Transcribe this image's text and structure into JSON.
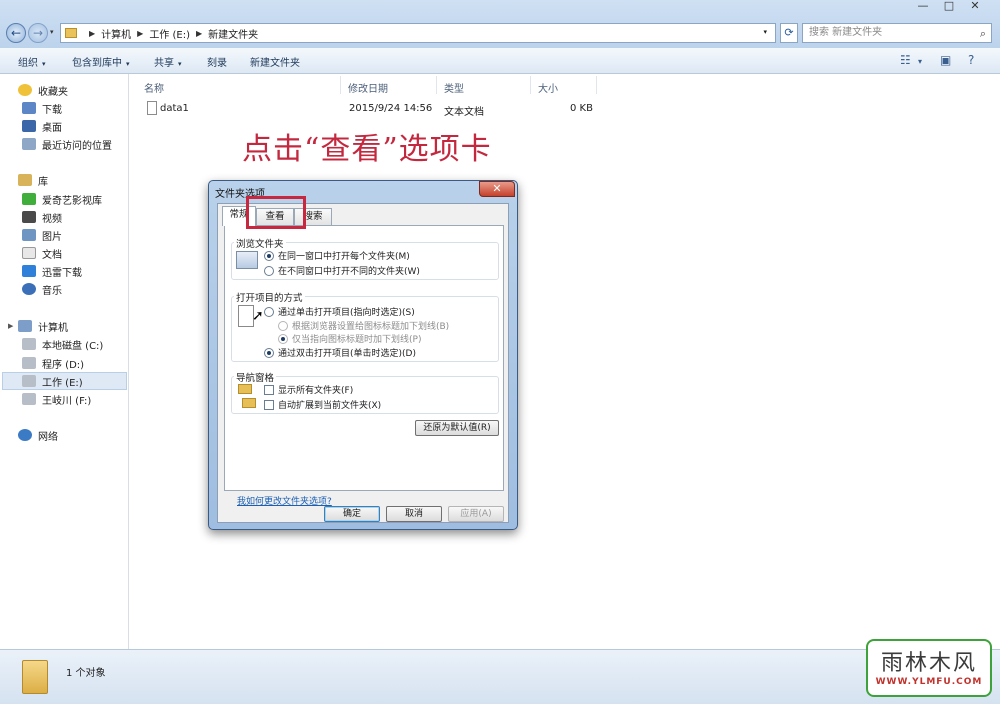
{
  "window": {
    "minimize": "—",
    "maximize": "□",
    "close": "✕",
    "breadcrumb": [
      "计算机",
      "工作 (E:)",
      "新建文件夹"
    ],
    "search_placeholder": "搜索 新建文件夹",
    "back_icon": "←",
    "forward_icon": "→",
    "refresh_icon": "⟳"
  },
  "toolbar": {
    "organize": "组织",
    "include_library": "包含到库中",
    "share": "共享",
    "burn": "刻录",
    "new_folder": "新建文件夹",
    "arrow": "▾"
  },
  "sidebar": {
    "favorites": "收藏夹",
    "downloads": "下载",
    "desktop": "桌面",
    "recent": "最近访问的位置",
    "libraries": "库",
    "iqiyi": "爱奇艺影视库",
    "videos": "视频",
    "pictures": "图片",
    "documents": "文档",
    "xunlei": "迅雷下载",
    "music": "音乐",
    "computer": "计算机",
    "drive_c": "本地磁盘 (C:)",
    "drive_d": "程序 (D:)",
    "drive_e": "工作 (E:)",
    "drive_f": "王岐川 (F:)",
    "network": "网络"
  },
  "filelist": {
    "columns": {
      "name": "名称",
      "modified": "修改日期",
      "type": "类型",
      "size": "大小"
    },
    "rows": [
      {
        "name": "data1",
        "modified": "2015/9/24 14:56",
        "type": "文本文档",
        "size": "0 KB"
      }
    ]
  },
  "annotation": "点击“查看”选项卡",
  "dialog": {
    "title": "文件夹选项",
    "close": "✕",
    "tabs": [
      "常规",
      "查看",
      "搜索"
    ],
    "browse_group": "浏览文件夹",
    "browse_same": "在同一窗口中打开每个文件夹(M)",
    "browse_new": "在不同窗口中打开不同的文件夹(W)",
    "click_group": "打开项目的方式",
    "single_click": "通过单击打开项目(指向时选定)(S)",
    "underline_browser": "根据浏览器设置给图标标题加下划线(B)",
    "underline_point": "仅当指向图标标题时加下划线(P)",
    "double_click": "通过双击打开项目(单击时选定)(D)",
    "nav_group": "导航窗格",
    "show_all": "显示所有文件夹(F)",
    "auto_expand": "自动扩展到当前文件夹(X)",
    "restore": "还原为默认值(R)",
    "help_link": "我如何更改文件夹选项?",
    "ok": "确定",
    "cancel": "取消",
    "apply": "应用(A)"
  },
  "status": {
    "count": "1 个对象"
  },
  "watermark": {
    "main": "雨林木风",
    "url": "WWW.YLMFU.COM"
  },
  "colors": {
    "highlight": "#c8283f",
    "accent": "#1f4c85"
  }
}
